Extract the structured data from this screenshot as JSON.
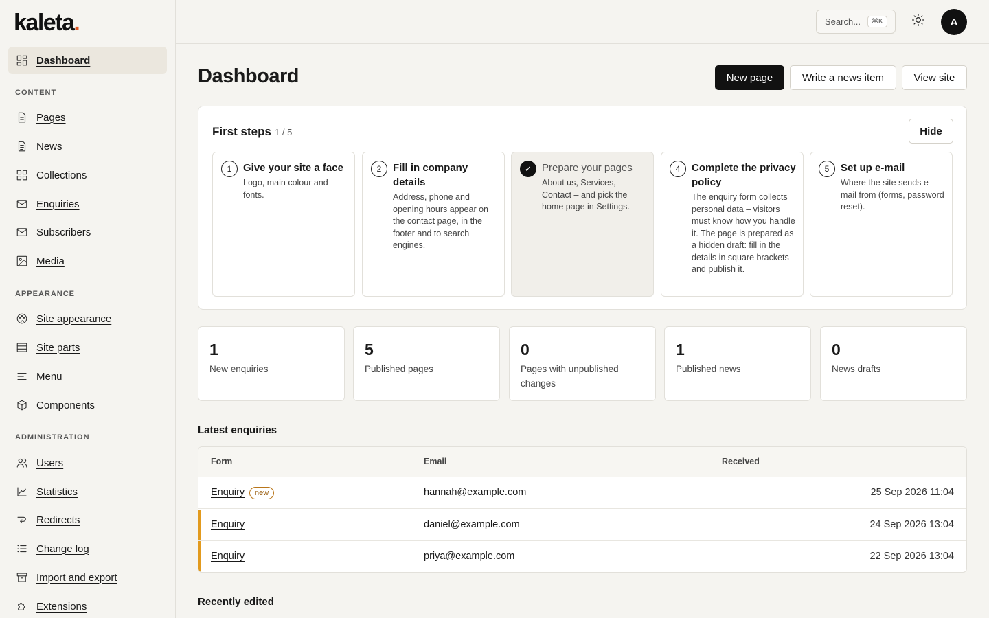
{
  "app": {
    "logo_text": "kaleta",
    "logo_dot": "."
  },
  "sidebar": {
    "dashboard": "Dashboard",
    "sections": {
      "content": "CONTENT",
      "appearance": "APPEARANCE",
      "administration": "ADMINISTRATION"
    },
    "content_items": [
      "Pages",
      "News",
      "Collections",
      "Enquiries",
      "Subscribers",
      "Media"
    ],
    "appearance_items": [
      "Site appearance",
      "Site parts",
      "Menu",
      "Components"
    ],
    "admin_items": [
      "Users",
      "Statistics",
      "Redirects",
      "Change log",
      "Import and export",
      "Extensions"
    ]
  },
  "topbar": {
    "search_label": "Search...",
    "search_kbd": "⌘K",
    "avatar_initial": "A"
  },
  "header": {
    "title": "Dashboard",
    "new_page": "New page",
    "write_news": "Write a news item",
    "view_site": "View site"
  },
  "first_steps": {
    "title": "First steps",
    "count": "1 / 5",
    "hide": "Hide",
    "steps": [
      {
        "num": "1",
        "title": "Give your site a face",
        "desc": "Logo, main colour and fonts."
      },
      {
        "num": "2",
        "title": "Fill in company details",
        "desc": "Address, phone and opening hours appear on the contact page, in the footer and to search engines."
      },
      {
        "num": "✓",
        "title": "Prepare your pages",
        "desc": "About us, Services, Contact – and pick the home page in Settings."
      },
      {
        "num": "4",
        "title": "Complete the privacy policy",
        "desc": "The enquiry form collects personal data – visitors must know how you handle it. The page is prepared as a hidden draft: fill in the details in square brackets and publish it."
      },
      {
        "num": "5",
        "title": "Set up e-mail",
        "desc": "Where the site sends e-mail from (forms, password reset)."
      }
    ]
  },
  "stats": [
    {
      "value": "1",
      "label": "New enquiries"
    },
    {
      "value": "5",
      "label": "Published pages"
    },
    {
      "value": "0",
      "label": "Pages with unpublished changes"
    },
    {
      "value": "1",
      "label": "Published news"
    },
    {
      "value": "0",
      "label": "News drafts"
    }
  ],
  "enquiries": {
    "title": "Latest enquiries",
    "columns": {
      "form": "Form",
      "email": "Email",
      "received": "Received"
    },
    "rows": [
      {
        "form": "Enquiry",
        "badge": "new",
        "email": "hannah@example.com",
        "received": "25 Sep 2026 11:04"
      },
      {
        "form": "Enquiry",
        "badge": "",
        "email": "daniel@example.com",
        "received": "24 Sep 2026 13:04"
      },
      {
        "form": "Enquiry",
        "badge": "",
        "email": "priya@example.com",
        "received": "22 Sep 2026 13:04"
      }
    ]
  },
  "recently_edited": {
    "title": "Recently edited"
  }
}
